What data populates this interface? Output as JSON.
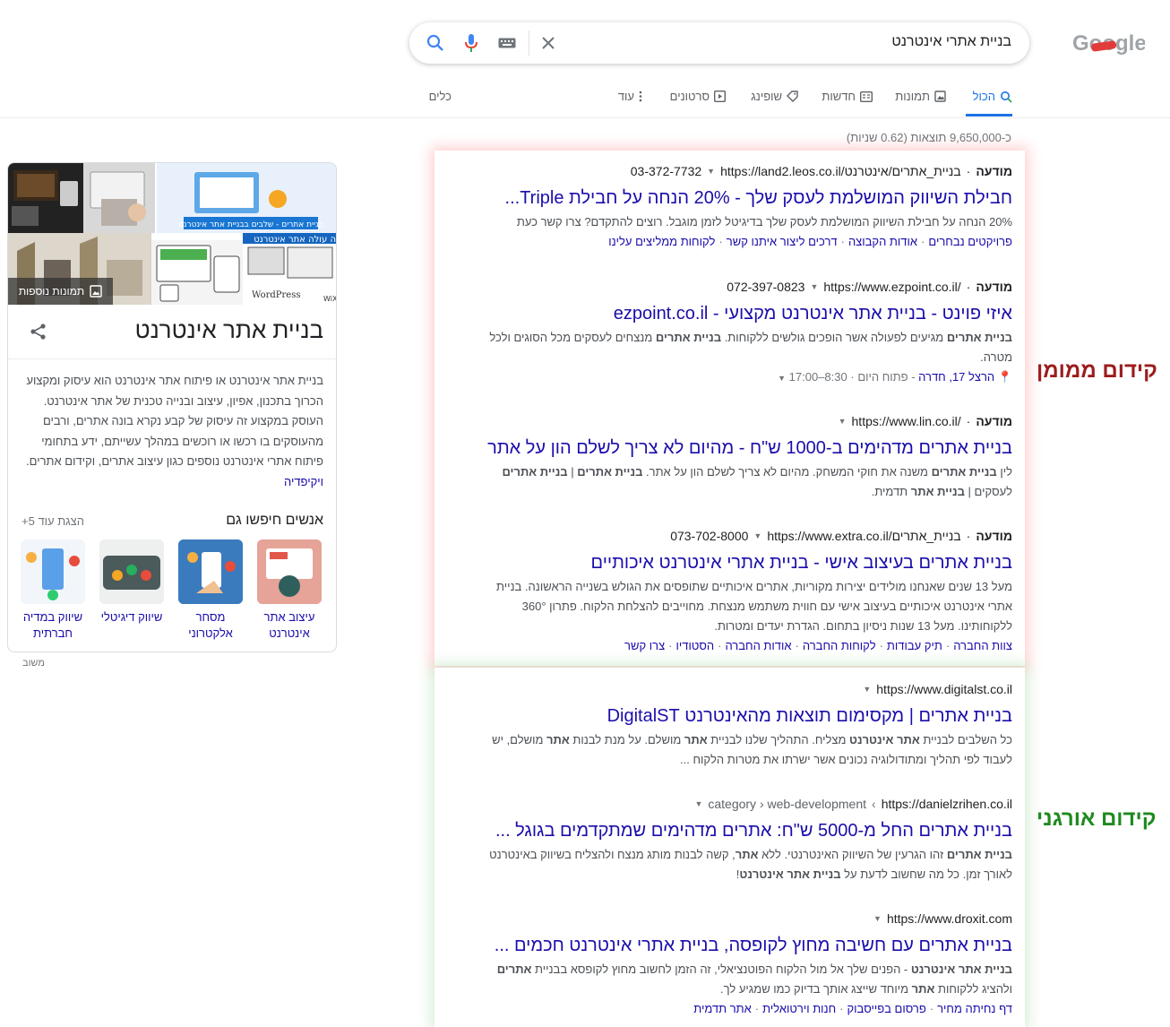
{
  "search": {
    "query": "בניית אתרי אינטרנט"
  },
  "tabs": [
    {
      "label": "הכול",
      "icon": "search-icon"
    },
    {
      "label": "תמונות",
      "icon": "image-icon"
    },
    {
      "label": "חדשות",
      "icon": "news-icon"
    },
    {
      "label": "שופינג",
      "icon": "tag-icon"
    },
    {
      "label": "סרטונים",
      "icon": "play-icon"
    },
    {
      "label": "עוד",
      "icon": "more-vert-icon"
    },
    {
      "label": "כלים",
      "icon": ""
    }
  ],
  "stats": "כ-9,650,000 תוצאות (0.62 שניות)",
  "ads": [
    {
      "label": "מודעה",
      "url": "https://land2.leos.co.il/בניית_אתרים/אינטרנט",
      "phone": "03-372-7732",
      "title": "חבילת השיווק המושלמת לעסק שלך - 20% הנחה על חבילת Triple...",
      "snippet": "20% הנחה על חבילת השיווק המושלמת לעסק שלך בדיגיטל לזמן מוגבל. רוצים להתקדם? צרו קשר כעת",
      "links": [
        "פרויקטים נבחרים",
        "אודות הקבוצה",
        "דרכים ליצור איתנו קשר",
        "לקוחות ממליצים עלינו"
      ]
    },
    {
      "label": "מודעה",
      "url": "https://www.ezpoint.co.il/",
      "phone": "072-397-0823",
      "title": "איזי פוינט - בניית אתר אינטרנט מקצועי - ezpoint.co.il",
      "snippet_b1": "בניית אתרים",
      "snippet": " מגיעים לפעולה אשר הופכים גולשים ללקוחות. ",
      "snippet_b2": "בניית אתרים",
      "snippet2": " מנצחים לעסקים מכל הסוגים ולכל מטרה.",
      "address": "הרצל 17, חדרה",
      "hours_prefix": "פתוח היום",
      "hours": "8:30–17:00"
    },
    {
      "label": "מודעה",
      "url": "https://www.lin.co.il/",
      "phone": "",
      "title": "בניית אתרים מדהימים ב-1000 ש\"ח - מהיום לא צריך לשלם הון על אתר",
      "snippet_p1": "לין ",
      "snippet_b1": "בניית אתרים",
      "snippet_p2": " משנה את חוקי המשחק. מהיום לא צריך לשלם הון על אתר. ",
      "snippet_b2": "בניית אתרים",
      "snippet_p3": " | ",
      "snippet_b3": "בניית אתרים",
      "snippet_p4": " לעסקים | ",
      "snippet_b4": "בניית אתר",
      "snippet_p5": " תדמית."
    },
    {
      "label": "מודעה",
      "url": "https://www.extra.co.il/בניית_אתרים",
      "phone": "073-702-8000",
      "title": "בניית אתרים בעיצוב אישי - בניית אתרי אינטרנט איכותיים",
      "snippet": "מעל 13 שנים שאנחנו מולידים יצירות מקוריות, אתרים איכותיים שתופסים את הגולש בשנייה הראשונה. בניית אתרי אינטרנט איכותיים בעיצוב אישי עם חווית משתמש מנצחת. מחוייבים להצלחת הלקוח. פתרון 360° ללקוחותינו. מעל 13 שנות ניסיון בתחום. הגדרת יעדים ומטרות.",
      "links": [
        "צוות החברה",
        "תיק עבודות",
        "לקוחות החברה",
        "אודות החברה",
        "הסטודיו",
        "צרו קשר"
      ]
    }
  ],
  "organic": [
    {
      "url": "https://www.digitalst.co.il",
      "title": "בניית אתרים | מקסימום תוצאות מהאינטרנט DigitalST",
      "snippet_p1": "כל השלבים לבניית ",
      "snippet_b1": "אתר אינטרנט",
      "snippet_p2": " מצליח. התהליך שלנו לבניית ",
      "snippet_b2": "אתר",
      "snippet_p3": " מושלם. על מנת לבנות ",
      "snippet_b3": "אתר",
      "snippet_p4": " מושלם, יש לעבוד לפי תהליך ומתודולוגיה נכונים אשר ישרתו את מטרות הלקוח ..."
    },
    {
      "url": "https://danielzrihen.co.il",
      "breadcrumb": "category › web-development",
      "title": "בניית אתרים החל מ-5000 ש\"ח: אתרים מדהימים שמתקדמים בגוגל ...",
      "snippet_b1": "בניית אתרים",
      "snippet_p1": " זהו הגרעין של השיווק האינטרנטי. ללא ",
      "snippet_b2": "אתר",
      "snippet_p2": ", קשה לבנות מותג מנצח ולהצליח בשיווק באינטרנט לאורך זמן. כל מה שחשוב לדעת על ",
      "snippet_b3": "בניית אתר אינטרנט",
      "snippet_p3": "!"
    },
    {
      "url": "https://www.droxit.com",
      "title": "בניית אתרים עם חשיבה מחוץ לקופסה, בניית אתרי אינטרנט חכמים ...",
      "snippet_b1": "בניית אתר אינטרנט",
      "snippet_p1": " - הפנים שלך אל מול הלקוח הפוטנציאלי, זה הזמן לחשוב מחוץ לקופסא בבניית ",
      "snippet_b2": "אתרים",
      "snippet_p2": " ולהציג ללקוחות ",
      "snippet_b3": "אתר",
      "snippet_p3": " מיוחד שייצג אותך בדיוק כמו שמגיע לך.",
      "links": [
        "דף נחיתה מחיר",
        "פרסום בפייסבוק",
        "חנות וירטואלית",
        "אתר תדמית"
      ]
    }
  ],
  "labels": {
    "paid": "קידום ממומן",
    "organic": "קידום אורגני",
    "paid_color": "#9c1c1c",
    "organic_color": "#1f8a1f"
  },
  "knowledge_panel": {
    "more_images": "תמונות נוספות",
    "title": "בניית אתר אינטרנט",
    "description": "בניית אתר אינטרנט או פיתוח אתר אינטרנט הוא עיסוק ומקצוע הכרוך בתכנון, אפיון, עיצוב ובנייה טכנית של אתר אינטרנט. העוסק במקצוע זה עיסוק של קבע נקרא בונה אתרים, ורבים מהעוסקים בו רכשו או רוכשים במהלך עשייתם, ידע בתחומי פיתוח אתרי אינטרנט נוספים כגון עיצוב אתרים, וקידום אתרים.",
    "wiki": "ויקיפדיה",
    "pasf_title": "אנשים חיפשו גם",
    "pasf_more": "הצגת עוד 5+",
    "pasf": [
      {
        "label": "עיצוב אתר אינטרנט"
      },
      {
        "label": "מסחר אלקטרוני"
      },
      {
        "label": "שיווק דיגיטלי"
      },
      {
        "label": "שיווק במדיה חברתית"
      }
    ],
    "image_texts": {
      "banner1": "בניית אתרים - שלבים בבניית אתר אינטרנט",
      "banner2": "ה עולה אתר אינטרנט",
      "wordpress": "WordPress",
      "wix": "WiX"
    }
  },
  "feedback": "משוב",
  "logo_text": "Google"
}
